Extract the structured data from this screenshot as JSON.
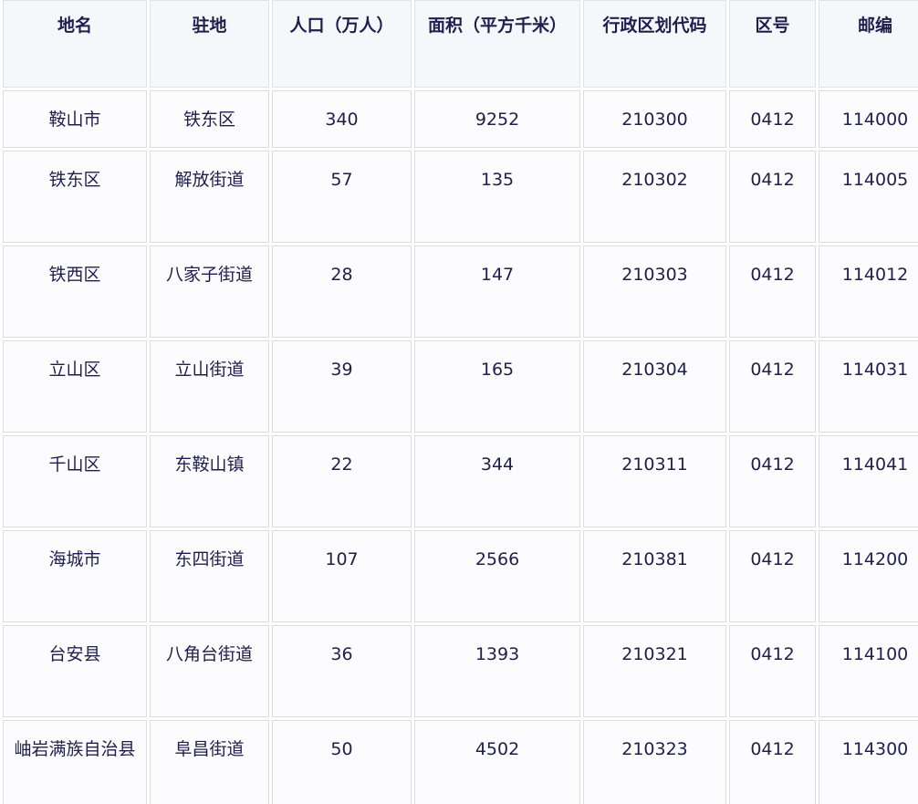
{
  "table": {
    "headers": [
      "地名",
      "驻地",
      "人口（万人）",
      "面积（平方千米）",
      "行政区划代码",
      "区号",
      "邮编"
    ],
    "rows": [
      [
        "鞍山市",
        "铁东区",
        "340",
        "9252",
        "210300",
        "0412",
        "114000"
      ],
      [
        "铁东区",
        "解放街道",
        "57",
        "135",
        "210302",
        "0412",
        "114005"
      ],
      [
        "铁西区",
        "八家子街道",
        "28",
        "147",
        "210303",
        "0412",
        "114012"
      ],
      [
        "立山区",
        "立山街道",
        "39",
        "165",
        "210304",
        "0412",
        "114031"
      ],
      [
        "千山区",
        "东鞍山镇",
        "22",
        "344",
        "210311",
        "0412",
        "114041"
      ],
      [
        "海城市",
        "东四街道",
        "107",
        "2566",
        "210381",
        "0412",
        "114200"
      ],
      [
        "台安县",
        "八角台街道",
        "36",
        "1393",
        "210321",
        "0412",
        "114100"
      ],
      [
        "岫岩满族自治县",
        "阜昌街道",
        "50",
        "4502",
        "210323",
        "0412",
        "114300"
      ]
    ]
  }
}
